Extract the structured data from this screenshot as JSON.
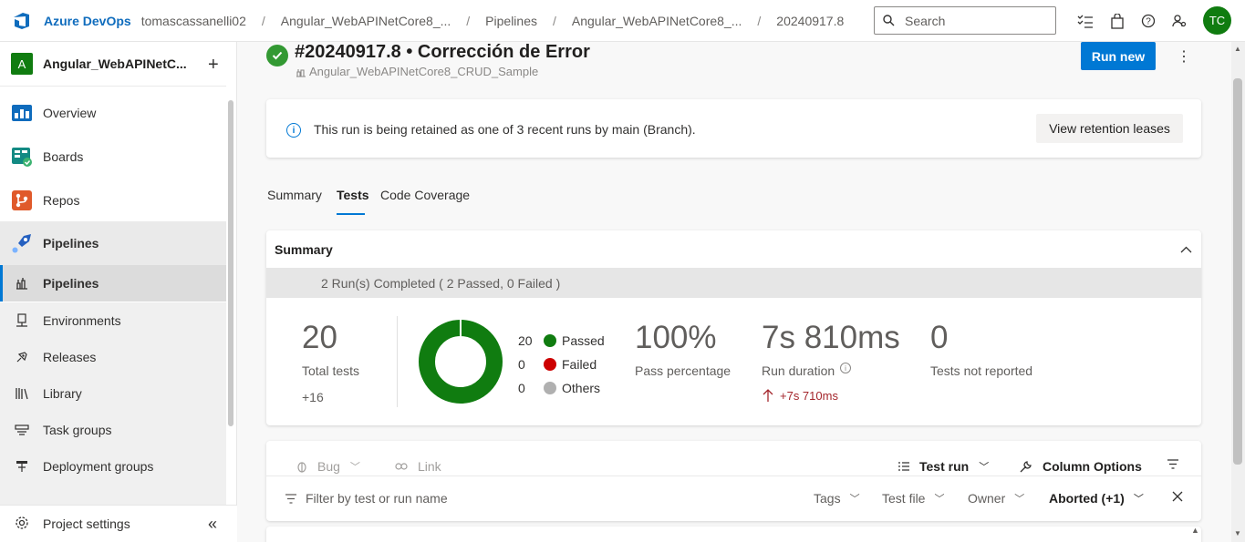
{
  "topbar": {
    "brand": "Azure DevOps",
    "breadcrumbs": [
      "tomascassanelli02",
      "Angular_WebAPINetCore8_...",
      "Pipelines",
      "Angular_WebAPINetCore8_...",
      "20240917.8"
    ],
    "search_placeholder": "Search",
    "avatar_initials": "TC"
  },
  "sidebar": {
    "project_initial": "A",
    "project_name": "Angular_WebAPINetC...",
    "items": [
      {
        "label": "Overview",
        "icon": "overview-icon"
      },
      {
        "label": "Boards",
        "icon": "boards-icon"
      },
      {
        "label": "Repos",
        "icon": "repos-icon"
      },
      {
        "label": "Pipelines",
        "icon": "pipelines-icon"
      }
    ],
    "sub_items": [
      {
        "label": "Pipelines",
        "icon": "pipeline-icon"
      },
      {
        "label": "Environments",
        "icon": "environment-icon"
      },
      {
        "label": "Releases",
        "icon": "release-icon"
      },
      {
        "label": "Library",
        "icon": "library-icon"
      },
      {
        "label": "Task groups",
        "icon": "task-group-icon"
      },
      {
        "label": "Deployment groups",
        "icon": "deployment-group-icon"
      }
    ],
    "settings_label": "Project settings"
  },
  "run": {
    "title": "#20240917.8 • Corrección de Error",
    "pipeline_name": "Angular_WebAPINetCore8_CRUD_Sample",
    "run_new_label": "Run new"
  },
  "retention": {
    "message": "This run is being retained as one of 3 recent runs by main (Branch).",
    "button_label": "View retention leases"
  },
  "tabs": [
    "Summary",
    "Tests",
    "Code Coverage"
  ],
  "active_tab": "Tests",
  "summary": {
    "heading": "Summary",
    "runs_completed": "2 Run(s) Completed ( 2 Passed, 0 Failed )",
    "total_tests": "20",
    "total_tests_label": "Total tests",
    "total_delta": "+16",
    "legend": [
      {
        "count": "20",
        "label": "Passed",
        "color": "#107c10"
      },
      {
        "count": "0",
        "label": "Failed",
        "color": "#cd0000"
      },
      {
        "count": "0",
        "label": "Others",
        "color": "#b0b0b0"
      }
    ],
    "pass_percentage": "100%",
    "pass_percentage_label": "Pass percentage",
    "run_duration": "7s 810ms",
    "run_duration_label": "Run duration",
    "duration_delta": "+7s 710ms",
    "not_reported": "0",
    "not_reported_label": "Tests not reported"
  },
  "toolbar": {
    "bug_label": "Bug",
    "link_label": "Link",
    "group_label": "Test run",
    "column_options_label": "Column Options"
  },
  "filters": {
    "placeholder": "Filter by test or run name",
    "tags_label": "Tags",
    "test_file_label": "Test file",
    "owner_label": "Owner",
    "outcome_label": "Aborted (+1)"
  }
}
